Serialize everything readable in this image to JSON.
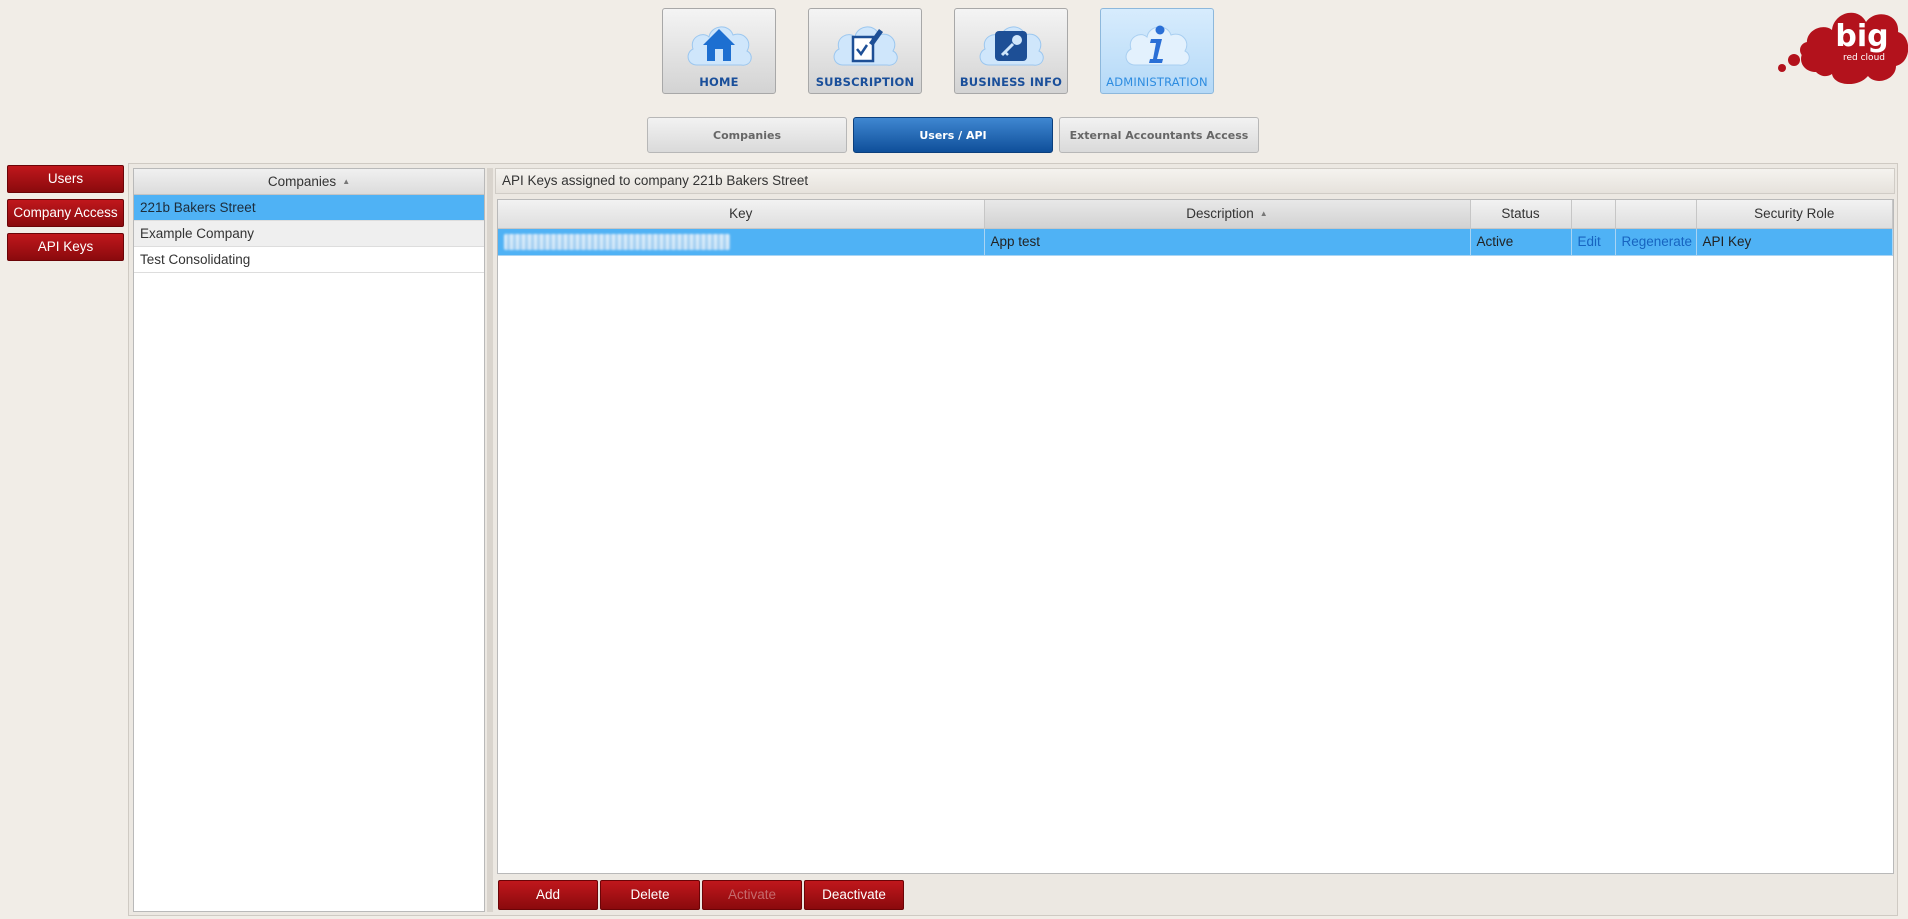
{
  "nav": {
    "tiles": [
      {
        "label": "HOME",
        "icon": "home-icon"
      },
      {
        "label": "SUBSCRIPTION",
        "icon": "edit-document-icon"
      },
      {
        "label": "BUSINESS INFO",
        "icon": "key-icon"
      },
      {
        "label": "ADMINISTRATION",
        "icon": "info-icon",
        "active": true
      }
    ]
  },
  "logo": {
    "text_main": "big",
    "text_sub": "red cloud"
  },
  "sub_tabs": [
    {
      "label": "Companies"
    },
    {
      "label": "Users / API",
      "active": true
    },
    {
      "label": "External Accountants Access"
    }
  ],
  "side_nav": [
    {
      "label": "Users"
    },
    {
      "label": "Company Access"
    },
    {
      "label": "API Keys"
    }
  ],
  "companies": {
    "header": "Companies",
    "rows": [
      "221b Bakers Street",
      "Example Company",
      "Test Consolidating"
    ],
    "selected_index": 0
  },
  "api_keys": {
    "title": "API Keys assigned to company 221b Bakers Street",
    "columns": [
      "Key",
      "Description",
      "Status",
      "",
      "",
      "Security Role"
    ],
    "sorted_column": "Description",
    "rows": [
      {
        "key": "",
        "description": "App test",
        "status": "Active",
        "edit": "Edit",
        "regenerate": "Regenerate",
        "security_role": "API Key"
      }
    ]
  },
  "actions": [
    {
      "label": "Add"
    },
    {
      "label": "Delete"
    },
    {
      "label": "Activate",
      "disabled": true
    },
    {
      "label": "Deactivate"
    }
  ],
  "colors": {
    "brand_red": "#a8101a",
    "selection_blue": "#4fb2f5",
    "active_tab_blue": "#0f4f9a"
  }
}
